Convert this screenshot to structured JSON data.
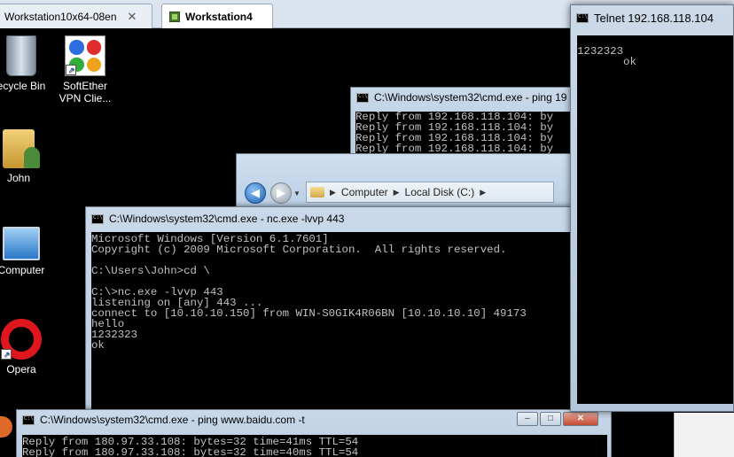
{
  "tabs": [
    {
      "label": "Workstation10x64-08en"
    },
    {
      "label": "Workstation4"
    }
  ],
  "desktop_icons": [
    {
      "label": "ecycle Bin",
      "icon": "recycle-bin-icon"
    },
    {
      "label": "SoftEther VPN Clie...",
      "icon": "softether-icon"
    },
    {
      "label": "John",
      "icon": "user-folder-icon"
    },
    {
      "label": "Computer",
      "icon": "computer-icon"
    },
    {
      "label": "Opera",
      "icon": "opera-icon"
    }
  ],
  "ping_back": {
    "title": "C:\\Windows\\system32\\cmd.exe - ping  19",
    "text": "Reply from 192.168.118.104: by\nReply from 192.168.118.104: by\nReply from 192.168.118.104: by\nReply from 192.168.118.104: by"
  },
  "explorer": {
    "path": [
      "Computer",
      "Local Disk (C:)"
    ]
  },
  "nc_window": {
    "title": "C:\\Windows\\system32\\cmd.exe - nc.exe  -lvvp 443",
    "text": "Microsoft Windows [Version 6.1.7601]\nCopyright (c) 2009 Microsoft Corporation.  All rights reserved.\n\nC:\\Users\\John>cd \\\n\nC:\\>nc.exe -lvvp 443\nlistening on [any] 443 ...\nconnect to [10.10.10.150] from WIN-S0GIK4R06BN [10.10.10.10] 49173\nhello\n1232323\nok"
  },
  "ping_front": {
    "title": "C:\\Windows\\system32\\cmd.exe - ping  www.baidu.com -t",
    "text": "Reply from 180.97.33.108: bytes=32 time=41ms TTL=54\nReply from 180.97.33.108: bytes=32 time=40ms TTL=54"
  },
  "telnet": {
    "title": "Telnet 192.168.118.104",
    "text": "\n1232323\n       ok"
  },
  "controls": {
    "minimize": "–",
    "maximize": "□",
    "close": "✕"
  }
}
